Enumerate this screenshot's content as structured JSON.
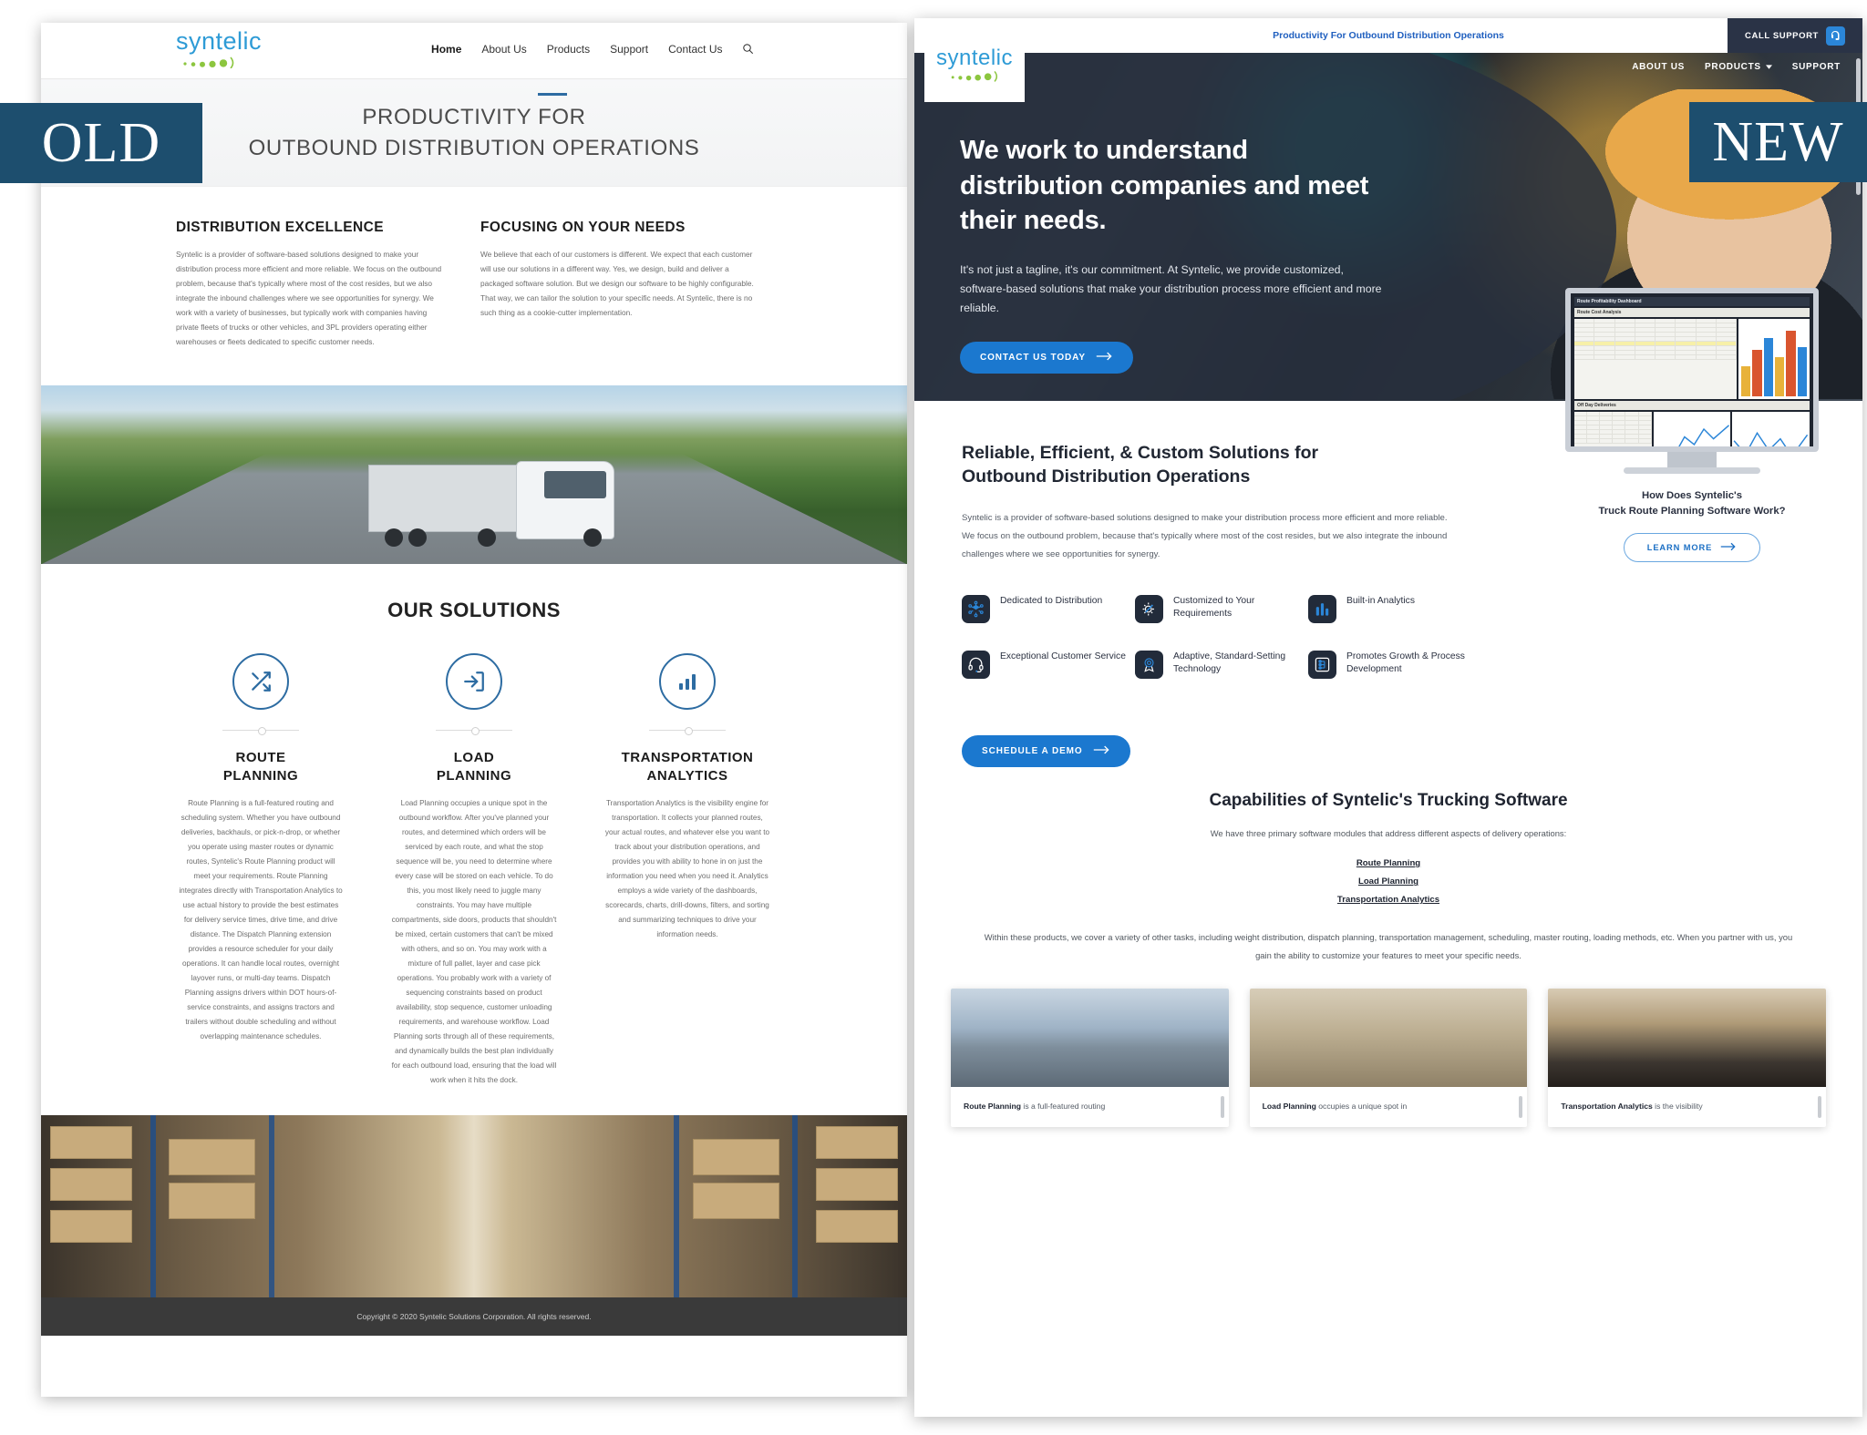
{
  "badges": {
    "old": "OLD",
    "new": "NEW"
  },
  "old_site": {
    "logo": {
      "word": "syntelic",
      "dots_count": 5
    },
    "nav": [
      {
        "label": "Home",
        "active": true
      },
      {
        "label": "About Us",
        "active": false
      },
      {
        "label": "Products",
        "active": false
      },
      {
        "label": "Support",
        "active": false
      },
      {
        "label": "Contact Us",
        "active": false
      }
    ],
    "search_icon": "search-icon",
    "hero": {
      "line1": "PRODUCTIVITY FOR",
      "line2": "OUTBOUND DISTRIBUTION OPERATIONS"
    },
    "columns": [
      {
        "heading": "DISTRIBUTION EXCELLENCE",
        "body": "Syntelic is a provider of software-based solutions designed to make your distribution process more efficient and more reliable. We focus on the outbound problem, because that's typically where most of the cost resides, but we also integrate the inbound challenges where we see opportunities for synergy. We work with a variety of businesses, but typically work with companies having private fleets of trucks or other vehicles, and 3PL providers operating either warehouses or fleets dedicated to specific customer needs."
      },
      {
        "heading": "FOCUSING ON YOUR NEEDS",
        "body": "We believe that each of our customers is different. We expect that each customer will use our solutions in a different way. Yes, we design, build and deliver a packaged software solution. But we design our software to be highly configurable. That way, we can tailor the solution to your specific needs. At Syntelic, there is no such thing as a cookie-cutter implementation."
      }
    ],
    "photo_alt": "white-semi-truck-on-highway-photo",
    "solutions_title": "OUR SOLUTIONS",
    "solutions": [
      {
        "icon": "shuffle-icon",
        "title_l1": "ROUTE",
        "title_l2": "PLANNING",
        "body": "Route Planning is a full-featured routing and scheduling system. Whether you have outbound deliveries, backhauls, or pick-n-drop, or whether you operate using master routes or dynamic routes, Syntelic's Route Planning product will meet your requirements. Route Planning integrates directly with Transportation Analytics to use actual history to provide the best estimates for delivery service times, drive time, and drive distance.  The Dispatch Planning extension provides a resource scheduler for your daily operations. It can handle local routes, overnight layover runs, or multi-day teams. Dispatch Planning assigns drivers within DOT hours-of-service constraints, and assigns tractors and trailers without double scheduling and without overlapping maintenance schedules."
      },
      {
        "icon": "login-arrow-icon",
        "title_l1": "LOAD",
        "title_l2": "PLANNING",
        "body": "Load Planning occupies a unique spot in the outbound workflow. After you've planned your routes, and determined which orders will be serviced by each route, and what the stop sequence will be, you need to determine where every case will be stored on each vehicle. To do this, you most likely need to juggle many constraints. You may have multiple compartments, side doors, products that shouldn't be mixed, certain customers that can't be mixed with others, and so on. You may work with a mixture of full pallet, layer and case pick operations. You probably work with a variety of sequencing constraints based on product availability, stop sequence, customer unloading requirements, and warehouse workflow. Load Planning sorts through all of these requirements, and dynamically builds the best plan individually for each outbound load, ensuring that the load will work when it hits the dock."
      },
      {
        "icon": "bar-chart-icon",
        "title_l1": "TRANSPORTATION",
        "title_l2": "ANALYTICS",
        "body": "Transportation Analytics is the visibility engine for transportation. It collects your planned routes, your actual routes, and whatever else you want to track about your distribution operations, and provides you with ability to hone in on just the information you need when you need it. Analytics employs a wide variety of the dashboards, scorecards, charts, drill-downs, filters, and sorting and summarizing techniques to drive your information needs."
      }
    ],
    "photo2_alt": "warehouse-aisle-with-pallet-racking-photo",
    "footer": "Copyright © 2020 Syntelic Solutions Corporation. All rights reserved."
  },
  "new_site": {
    "utility_bar": {
      "tagline": "Productivity For Outbound Distribution Operations",
      "call_support": "CALL SUPPORT",
      "support_icon": "headset-icon"
    },
    "logo": {
      "word": "syntelic",
      "dots_count": 5
    },
    "nav": [
      {
        "label": "ABOUT US",
        "has_dropdown": false
      },
      {
        "label": "PRODUCTS",
        "has_dropdown": true
      },
      {
        "label": "SUPPORT",
        "has_dropdown": false
      }
    ],
    "hero": {
      "heading": "We work to understand distribution companies and meet their needs.",
      "body": "It's not just a tagline, it's our commitment. At Syntelic, we provide customized, software-based solutions that make your distribution process more efficient and more reliable.",
      "cta": "CONTACT US TODAY",
      "cta_icon": "arrow-right-icon",
      "photo_alt": "truck-driver-with-beanie-smiling-photo"
    },
    "solutions": {
      "heading_l1": "Reliable, Efficient, & Custom Solutions for",
      "heading_l2": "Outbound Distribution Operations",
      "body": "Syntelic is a provider of software-based solutions designed to make your distribution process more efficient and more reliable. We focus on the outbound problem, because that's typically where most of the cost resides, but we also integrate the inbound challenges where we see opportunities for synergy.",
      "features": [
        {
          "icon": "network-cube-icon",
          "label": "Dedicated to Distribution"
        },
        {
          "icon": "gear-pencil-icon",
          "label": "Customized to Your Requirements"
        },
        {
          "icon": "bar-chart-icon",
          "label": "Built-in Analytics"
        },
        {
          "icon": "headset-icon",
          "label": "Exceptional Customer Service"
        },
        {
          "icon": "award-ribbon-icon",
          "label": "Adaptive, Standard-Setting Technology"
        },
        {
          "icon": "flow-nodes-icon",
          "label": "Promotes Growth & Process Development"
        }
      ],
      "demo_cta": "SCHEDULE A DEMO",
      "demo_cta_icon": "arrow-right-icon",
      "monitor_caption_l1": "How Does Syntelic's",
      "monitor_caption_l2": "Truck Route Planning Software Work?",
      "learn_more": "LEARN MORE",
      "learn_more_icon": "arrow-right-icon",
      "monitor_screen_title": "Route Profitability Dashboard",
      "monitor_panel_1": "Route Cost Analysis",
      "monitor_panel_2": "Off Day Deliveries"
    },
    "capabilities": {
      "heading": "Capabilities of Syntelic's Trucking Software",
      "subtitle": "We have three primary software modules that address different aspects of delivery operations:",
      "links": [
        "Route Planning",
        "Load Planning",
        "Transportation Analytics"
      ],
      "note": "Within these products, we cover a variety of other tasks, including weight distribution, dispatch planning, transportation management, scheduling, master routing, loading methods, etc. When you partner with us, you gain the ability to customize your features to meet your specific needs."
    },
    "cards": [
      {
        "photo_alt": "semi-truck-on-snowy-road-photo",
        "title": "Route Planning",
        "text": " is a full-featured routing"
      },
      {
        "photo_alt": "forklift-loading-truck-photo",
        "title": "Load Planning",
        "text": " occupies a unique spot in"
      },
      {
        "photo_alt": "stacked-truck-tires-photo",
        "title": "Transportation Analytics",
        "text": " is the visibility"
      }
    ]
  },
  "colors": {
    "badge_navy": "#1d4e6e",
    "brand_blue": "#2e9bd6",
    "brand_green": "#8cc63f",
    "accent_blue": "#1b78cf",
    "dark_navy": "#222b3a",
    "old_accent": "#2d6ca2"
  }
}
